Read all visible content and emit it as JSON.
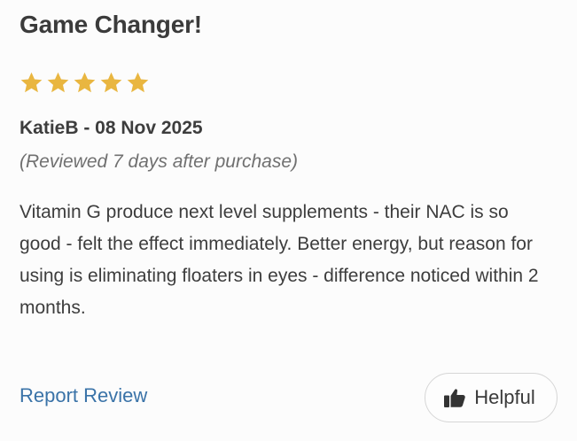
{
  "review": {
    "title": "Game Changer!",
    "rating": 5,
    "rating_max": 5,
    "star_color": "#e9b640",
    "author_date": "KatieB - 08 Nov 2025",
    "reviewed_note": "(Reviewed 7 days after purchase)",
    "body": "Vitamin G produce next level supplements - their NAC is so good - felt the effect immediately. Better energy, but reason for using is eliminating floaters in eyes - difference noticed within 2 months."
  },
  "actions": {
    "report_label": "Report Review",
    "report_color": "#3a73a8",
    "helpful_label": "Helpful",
    "helpful_icon": "thumbs-up-icon"
  }
}
